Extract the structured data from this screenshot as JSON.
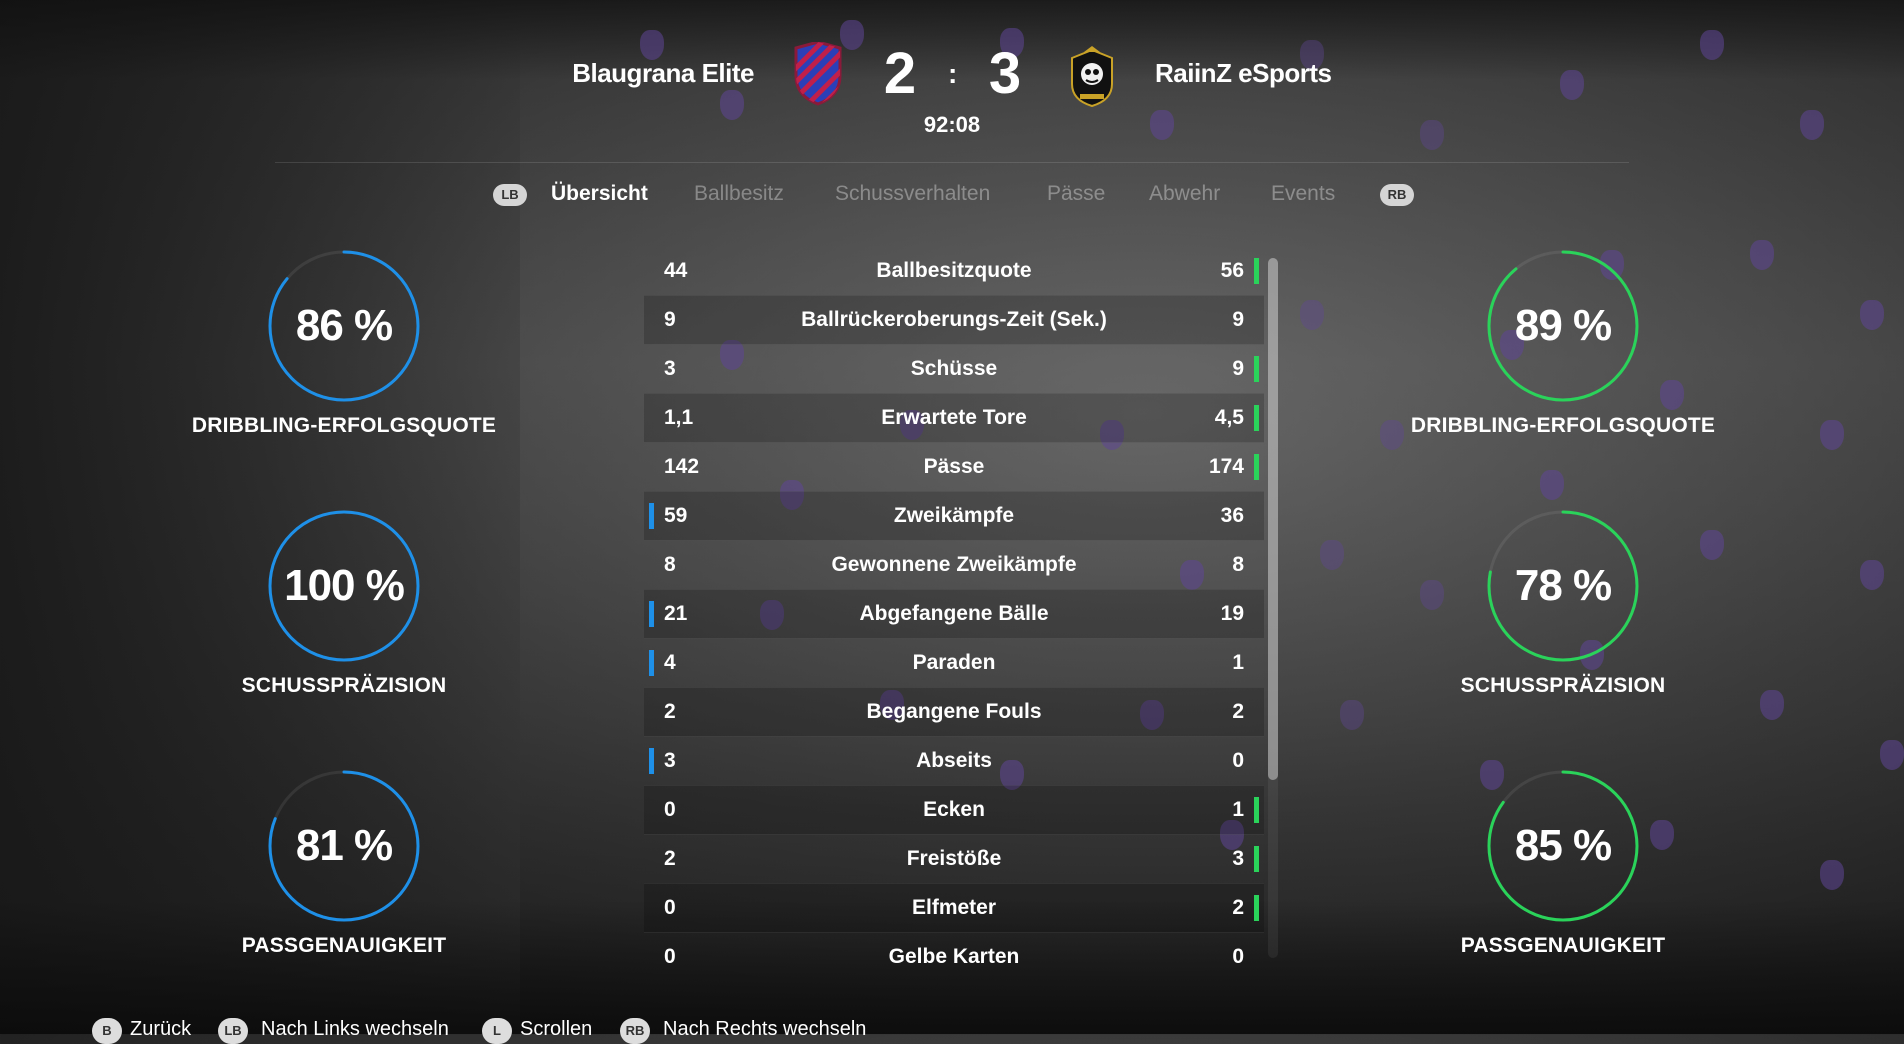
{
  "match": {
    "home_team": "Blaugrana Elite",
    "away_team": "RaiinZ eSports",
    "home_score": "2",
    "separator": ":",
    "away_score": "3",
    "clock": "92:08"
  },
  "tabs": {
    "lb_label": "LB",
    "rb_label": "RB",
    "items": [
      "Übersicht",
      "Ballbesitz",
      "Schussverhalten",
      "Pässe",
      "Abwehr",
      "Events"
    ],
    "active_index": 0
  },
  "colors": {
    "home_accent": "#1e90e8",
    "away_accent": "#2ad35a"
  },
  "home_circles": [
    {
      "value": "86 %",
      "percent": 86,
      "label": "DRIBBLING-ERFOLGSQUOTE"
    },
    {
      "value": "100 %",
      "percent": 100,
      "label": "SCHUSSPRÄZISION"
    },
    {
      "value": "81 %",
      "percent": 81,
      "label": "PASSGENAUIGKEIT"
    }
  ],
  "away_circles": [
    {
      "value": "89 %",
      "percent": 89,
      "label": "DRIBBLING-ERFOLGSQUOTE"
    },
    {
      "value": "78 %",
      "percent": 78,
      "label": "SCHUSSPRÄZISION"
    },
    {
      "value": "85 %",
      "percent": 85,
      "label": "PASSGENAUIGKEIT"
    }
  ],
  "stats": [
    {
      "home": "44",
      "label": "Ballbesitzquote",
      "away": "56",
      "leader": "away"
    },
    {
      "home": "9",
      "label": "Ballrückeroberungs-Zeit (Sek.)",
      "away": "9",
      "leader": "none"
    },
    {
      "home": "3",
      "label": "Schüsse",
      "away": "9",
      "leader": "away"
    },
    {
      "home": "1,1",
      "label": "Erwartete Tore",
      "away": "4,5",
      "leader": "away"
    },
    {
      "home": "142",
      "label": "Pässe",
      "away": "174",
      "leader": "away"
    },
    {
      "home": "59",
      "label": "Zweikämpfe",
      "away": "36",
      "leader": "home"
    },
    {
      "home": "8",
      "label": "Gewonnene Zweikämpfe",
      "away": "8",
      "leader": "none"
    },
    {
      "home": "21",
      "label": "Abgefangene Bälle",
      "away": "19",
      "leader": "home"
    },
    {
      "home": "4",
      "label": "Paraden",
      "away": "1",
      "leader": "home"
    },
    {
      "home": "2",
      "label": "Begangene Fouls",
      "away": "2",
      "leader": "none"
    },
    {
      "home": "3",
      "label": "Abseits",
      "away": "0",
      "leader": "home"
    },
    {
      "home": "0",
      "label": "Ecken",
      "away": "1",
      "leader": "away"
    },
    {
      "home": "2",
      "label": "Freistöße",
      "away": "3",
      "leader": "away"
    },
    {
      "home": "0",
      "label": "Elfmeter",
      "away": "2",
      "leader": "away"
    },
    {
      "home": "0",
      "label": "Gelbe Karten",
      "away": "0",
      "leader": "none"
    }
  ],
  "footer": {
    "back_btn": "B",
    "back_label": "Zurück",
    "left_btn": "LB",
    "left_label": "Nach Links wechseln",
    "scroll_btn": "L",
    "scroll_label": "Scrollen",
    "right_btn": "RB",
    "right_label": "Nach Rechts wechseln"
  }
}
